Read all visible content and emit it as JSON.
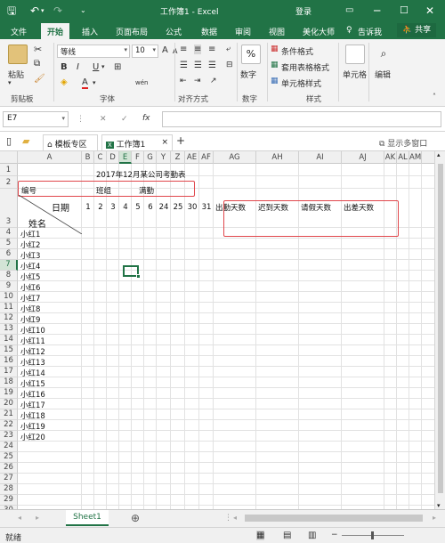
{
  "app": {
    "title": "工作簿1 - Excel",
    "login": "登录",
    "brand_color": "#217346"
  },
  "menu": {
    "file": "文件",
    "tabs": [
      "开始",
      "插入",
      "页面布局",
      "公式",
      "数据",
      "审阅",
      "视图",
      "美化大师"
    ],
    "tell_me": "告诉我",
    "share": "共享"
  },
  "ribbon": {
    "clipboard": {
      "paste": "粘贴",
      "label": "剪贴板"
    },
    "font": {
      "name": "等线",
      "size": "10",
      "bold": "B",
      "italic": "I",
      "underline": "U",
      "grow": "A",
      "shrink": "A",
      "font_color": "A",
      "wen": "wén",
      "label": "字体"
    },
    "alignment": {
      "label": "对齐方式"
    },
    "number": {
      "percent": "%",
      "label": "数字"
    },
    "styles": {
      "conditional": "条件格式",
      "table": "套用表格格式",
      "cell": "单元格样式",
      "label": "样式"
    },
    "cells": {
      "label": "单元格"
    },
    "editing": {
      "label": "编辑"
    }
  },
  "formula_bar": {
    "name_box": "E7",
    "cancel": "✕",
    "enter": "✓",
    "fx": "fx",
    "value": ""
  },
  "doc_tabs": {
    "template": "模板专区",
    "workbook": "工作簿1",
    "new_tab": "+",
    "multi_window": "显示多窗口"
  },
  "columns": [
    "A",
    "B",
    "C",
    "D",
    "E",
    "F",
    "G",
    "Y",
    "Z",
    "AE",
    "AF",
    "AG",
    "AH",
    "AI",
    "AJ",
    "AK",
    "AL",
    "AM"
  ],
  "selected_column": "E",
  "selected_row": "7",
  "rows": [
    "1",
    "2",
    "3",
    "4",
    "5",
    "6",
    "7",
    "8",
    "9",
    "10",
    "11",
    "12",
    "13",
    "14",
    "15",
    "16",
    "17",
    "18",
    "19",
    "20",
    "21",
    "22",
    "23",
    "24",
    "25",
    "26",
    "27",
    "28",
    "29",
    "30"
  ],
  "sheet": {
    "title": "2017年12月某公司考勤表",
    "row2": {
      "id": "编号",
      "team": "班组",
      "shift": "满勤"
    },
    "corner_top": "日期",
    "corner_bottom": "姓名",
    "days": [
      "1",
      "2",
      "3",
      "4",
      "5",
      "6",
      "24",
      "25",
      "30",
      "31"
    ],
    "summary_headers": [
      "出勤天数",
      "迟到天数",
      "请假天数",
      "出差天数"
    ],
    "names": [
      "小红1",
      "小红2",
      "小红3",
      "小红4",
      "小红5",
      "小红6",
      "小红7",
      "小红8",
      "小红9",
      "小红10",
      "小红11",
      "小红12",
      "小红13",
      "小红14",
      "小红15",
      "小红16",
      "小红17",
      "小红18",
      "小红19",
      "小红20"
    ]
  },
  "sheet_tabs": {
    "active": "Sheet1",
    "add": "⊕"
  },
  "status": {
    "ready": "就绪"
  }
}
